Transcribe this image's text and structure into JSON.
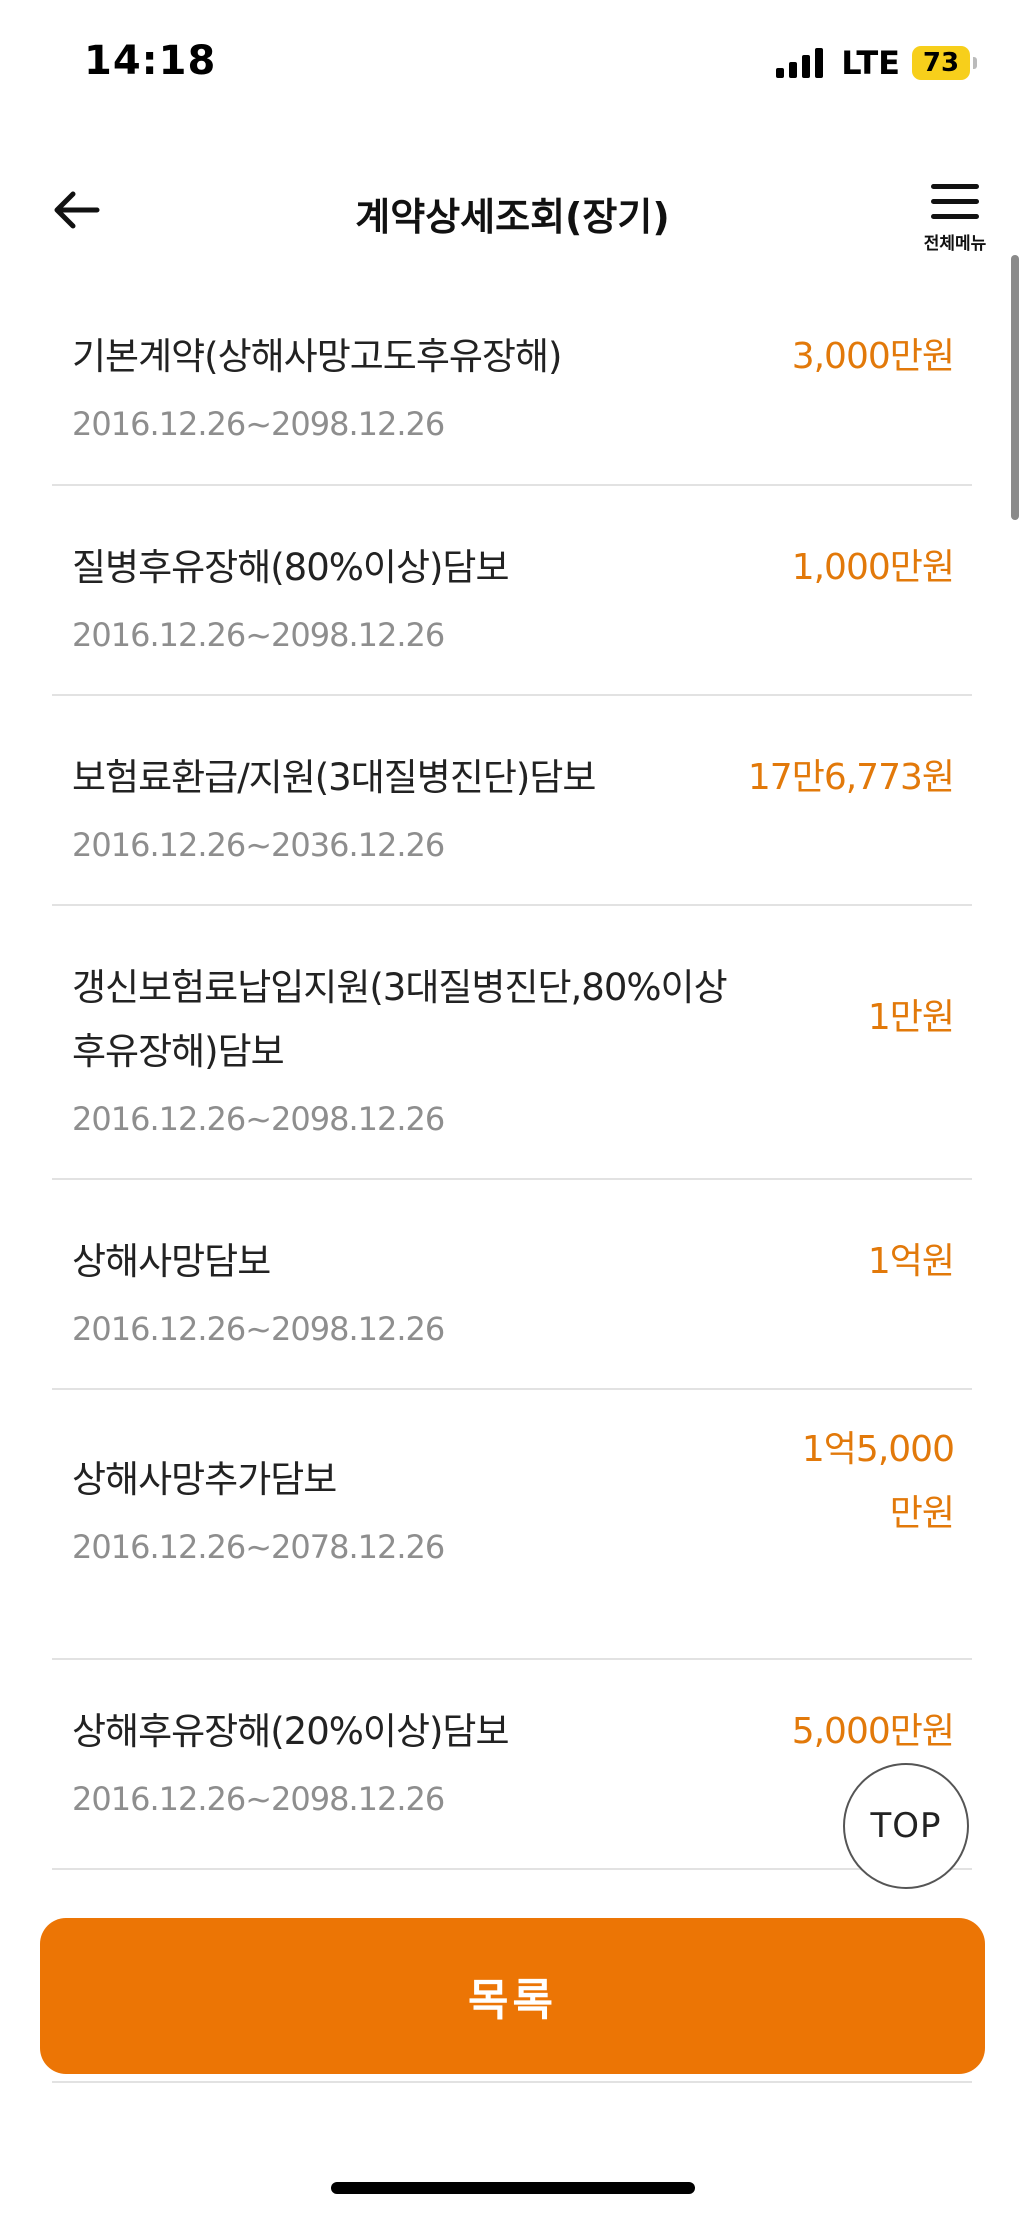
{
  "status_bar": {
    "time": "14:18",
    "network": "LTE",
    "battery": "73"
  },
  "header": {
    "title": "계약상세조회(장기)",
    "menu_label": "전체메뉴"
  },
  "coverages": [
    {
      "name": "기본계약(상해사망고도후유장해)",
      "period": "2016.12.26~2098.12.26",
      "amount": "3,000만원"
    },
    {
      "name": "질병후유장해(80%이상)담보",
      "period": "2016.12.26~2098.12.26",
      "amount": "1,000만원"
    },
    {
      "name": "보험료환급/지원(3대질병진단)담보",
      "period": "2016.12.26~2036.12.26",
      "amount": "17만6,773원"
    },
    {
      "name": "갱신보험료납입지원(3대질병진단,80%이상후유장해)담보",
      "period": "2016.12.26~2098.12.26",
      "amount": "1만원"
    },
    {
      "name": "상해사망담보",
      "period": "2016.12.26~2098.12.26",
      "amount": "1억원"
    },
    {
      "name": "상해사망추가담보",
      "period": "2016.12.26~2078.12.26",
      "amount": "1억5,000만원"
    },
    {
      "name": "상해후유장해(20%이상)담보",
      "period": "2016.12.26~2098.12.26",
      "amount": "5,000만원"
    }
  ],
  "top_button_label": "TOP",
  "list_button_label": "목록",
  "colors": {
    "accent": "#ec7505",
    "amount": "#e2790a",
    "battery": "#f7cf1b"
  },
  "icons": {
    "back": "back-arrow-icon",
    "menu": "hamburger-menu-icon",
    "signal": "signal-icon",
    "battery": "battery-icon"
  }
}
